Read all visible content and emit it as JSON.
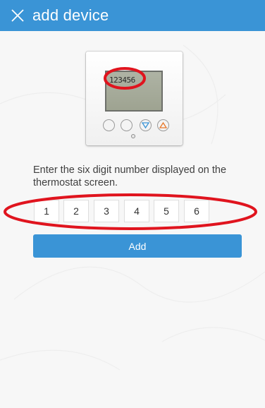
{
  "header": {
    "title": "add device",
    "close_icon": "close-icon"
  },
  "device": {
    "lcd_text": "123456"
  },
  "instruction": "Enter the six digit number displayed on the thermostat screen.",
  "digits": [
    "1",
    "2",
    "3",
    "4",
    "5",
    "6"
  ],
  "add_button": {
    "label": "Add"
  },
  "colors": {
    "accent": "#3a94d6",
    "highlight": "#e0141e"
  }
}
